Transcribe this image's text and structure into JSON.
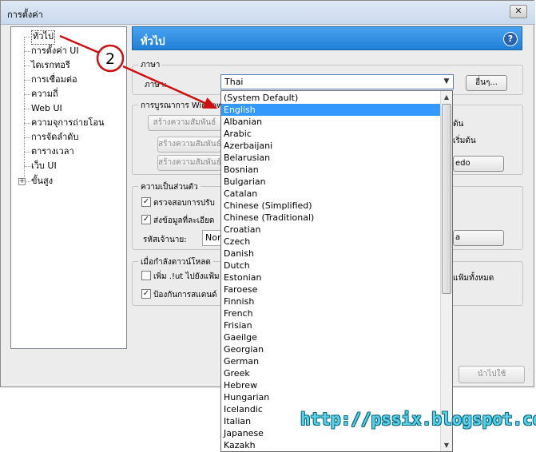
{
  "window": {
    "title": "การตั้งค่า",
    "close_glyph": "✕"
  },
  "tree": {
    "items": [
      {
        "label": "ทั่วไป"
      },
      {
        "label": "การตั้งค่า UI"
      },
      {
        "label": "ไดเรกทอรี"
      },
      {
        "label": "การเชื่อมต่อ"
      },
      {
        "label": "ความถี่"
      },
      {
        "label": "Web UI"
      },
      {
        "label": "ความจุการถ่ายโอน"
      },
      {
        "label": "การจัดลำดับ"
      },
      {
        "label": "ตารางเวลา"
      },
      {
        "label": "เว็บ UI"
      },
      {
        "label": "ขั้นสูง"
      }
    ],
    "expander_glyph": "+"
  },
  "header": {
    "title": "ทั่วไป",
    "help_glyph": "?"
  },
  "language": {
    "group_title": "ภาษา",
    "label": "ภาษา:",
    "selected_value": "Thai",
    "more_button": "อื่นๆ..."
  },
  "windows_integration": {
    "group_title": "การบูรณาการ Windows",
    "buttons": [
      "สร้างความสัมพันธ์",
      "สร้างความสัมพันธ์",
      "สร้างความสัมพันธ์"
    ],
    "right_texts": [
      "ต้น",
      "เริ่มต้น"
    ],
    "right_button": "edo"
  },
  "privacy": {
    "group_title": "ความเป็นส่วนตัว",
    "check1_label": "ตรวจสอบการปรับ",
    "check2_label": "ส่งข้อมูลที่ละเอียด",
    "owner_label": "รหัสเจ้านาย:",
    "owner_value": "Nor",
    "right_button": "a"
  },
  "download": {
    "group_title": "เมื่อกำลังดาวน์โหลด",
    "check1_label": "เพิ่ม .!ut ไปยังแฟ้ม",
    "check2_label": "ป้องกันการสแตนด์",
    "right_text": "แฟ้มทั้งหมด"
  },
  "footer": {
    "apply_button": "นำไปใช้"
  },
  "dropdown": {
    "items": [
      {
        "label": "(System Default)"
      },
      {
        "label": "English",
        "selected": true
      },
      {
        "label": "Albanian"
      },
      {
        "label": "Arabic"
      },
      {
        "label": "Azerbaijani"
      },
      {
        "label": "Belarusian"
      },
      {
        "label": "Bosnian"
      },
      {
        "label": "Bulgarian"
      },
      {
        "label": "Catalan"
      },
      {
        "label": "Chinese (Simplified)"
      },
      {
        "label": "Chinese (Traditional)"
      },
      {
        "label": "Croatian"
      },
      {
        "label": "Czech"
      },
      {
        "label": "Danish"
      },
      {
        "label": "Dutch"
      },
      {
        "label": "Estonian"
      },
      {
        "label": "Faroese"
      },
      {
        "label": "Finnish"
      },
      {
        "label": "French"
      },
      {
        "label": "Frisian"
      },
      {
        "label": "Gaeilge"
      },
      {
        "label": "Georgian"
      },
      {
        "label": "German"
      },
      {
        "label": "Greek"
      },
      {
        "label": "Hebrew"
      },
      {
        "label": "Hungarian"
      },
      {
        "label": "Icelandic"
      },
      {
        "label": "Italian"
      },
      {
        "label": "Japanese"
      },
      {
        "label": "Kazakh"
      }
    ]
  },
  "annotation": {
    "step_number": "2",
    "color": "#d01010"
  },
  "watermark": {
    "text": "http://pssix.blogspot.com"
  }
}
